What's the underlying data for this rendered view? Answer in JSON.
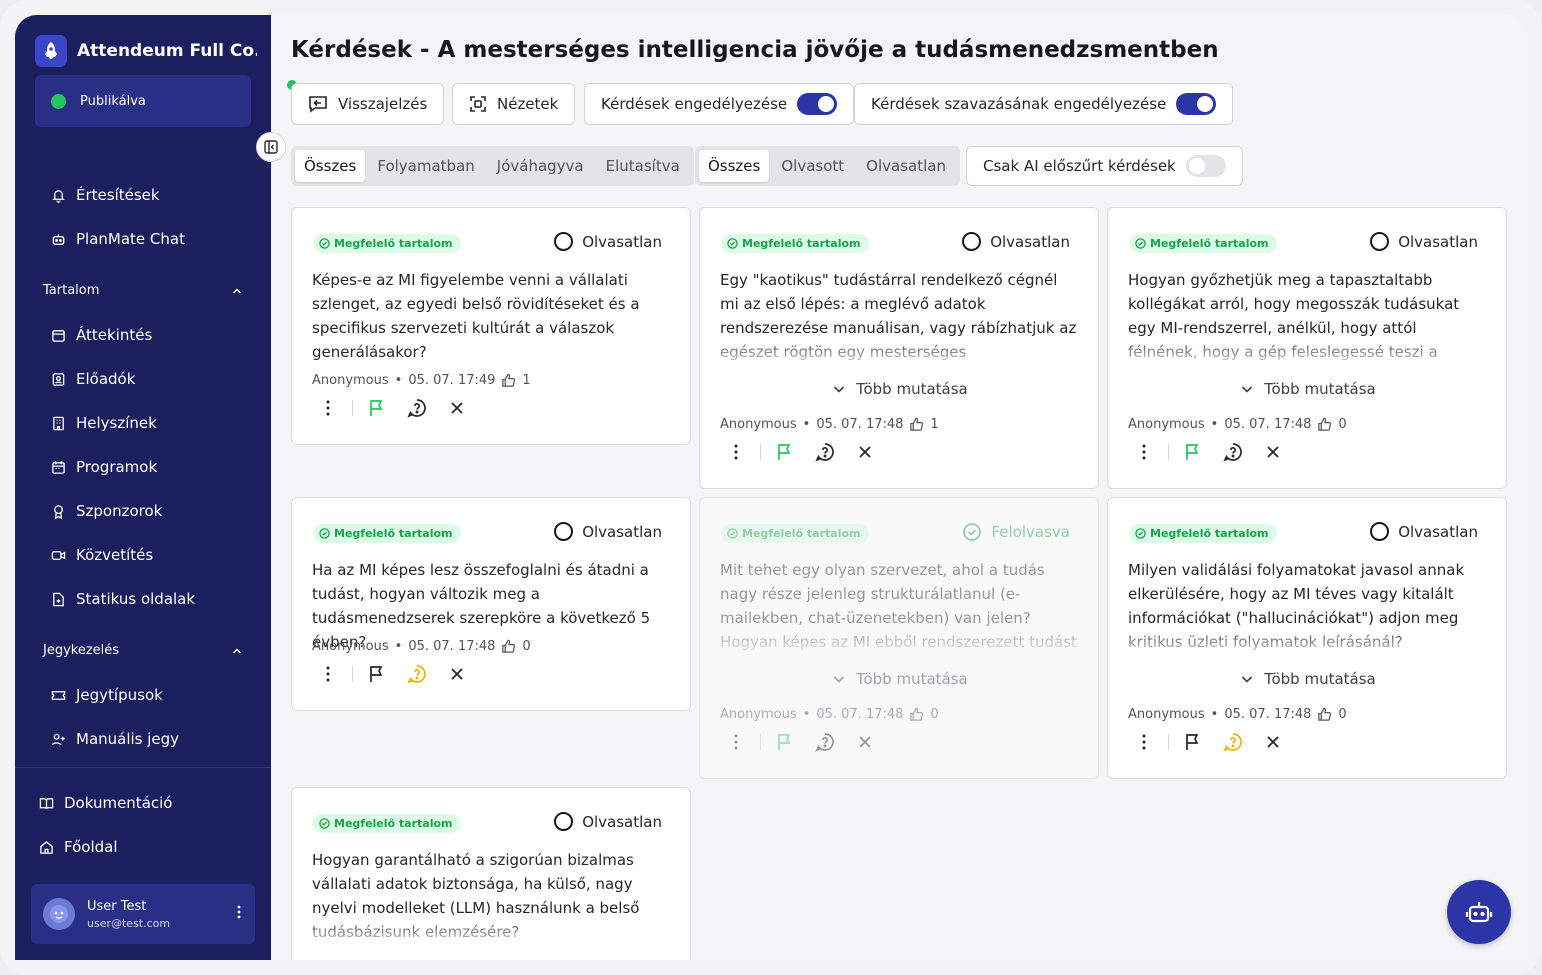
{
  "sidebar": {
    "brand": "Attendeum Full Co...",
    "status": "Publikálva",
    "nav_top": [
      "Értesítések",
      "PlanMate Chat"
    ],
    "section_content": "Tartalom",
    "content_items": [
      "Áttekintés",
      "Előadók",
      "Helyszínek",
      "Programok",
      "Szponzorok",
      "Közvetítés",
      "Statikus oldalak"
    ],
    "section_ticket": "Jegykezelés",
    "ticket_items": [
      "Jegytípusok",
      "Manuális jegy"
    ],
    "bottom_items": [
      "Dokumentáció",
      "Főoldal"
    ],
    "user": {
      "name": "User Test",
      "email": "user@test.com"
    }
  },
  "header": {
    "title": "Kérdések - A mesterséges intelligencia jövője a tudásmenedzsmentben",
    "feedback": "Visszajelzés",
    "views": "Nézetek",
    "allow_questions": "Kérdések engedélyezése",
    "allow_voting": "Kérdések szavazásának engedélyezése"
  },
  "filters": {
    "status_tabs": [
      "Összes",
      "Folyamatban",
      "Jóváhagyva",
      "Elutasítva"
    ],
    "read_tabs": [
      "Összes",
      "Olvasott",
      "Olvasatlan"
    ],
    "ai_filter": "Csak AI előszűrt kérdések"
  },
  "labels": {
    "badge": "Megfelelő tartalom",
    "unread": "Olvasatlan",
    "read": "Felolvasva",
    "more": "Több mutatása"
  },
  "questions": [
    {
      "text": "Képes-e az MI figyelembe venni a vállalati szlenget, az egyedi belső rövidítéseket és a specifikus szervezeti kultúrát a válaszok generálásakor?",
      "author": "Anonymous",
      "time": "05. 07. 17:49",
      "votes": "1"
    },
    {
      "text": "Egy \"kaotikus\" tudástárral rendelkező cégnél mi az első lépés: a meglévő adatok rendszerezése manuálisan, vagy rábízhatjuk az egészet rögtön egy mesterséges intelligenciára?",
      "author": "Anonymous",
      "time": "05. 07. 17:48",
      "votes": "1"
    },
    {
      "text": "Hogyan győzhetjük meg a tapasztaltabb kollégákat arról, hogy megosszák tudásukat egy MI-rendszerrel, anélkül, hogy attól félnének, hogy a gép feleslegessé teszi a munkájukat?",
      "author": "Anonymous",
      "time": "05. 07. 17:48",
      "votes": "0"
    },
    {
      "text": "Ha az MI képes lesz összefoglalni és átadni a tudást, hogyan változik meg a tudásmenedzserek szerepköre a következő 5 évben?",
      "author": "Anonymous",
      "time": "05. 07. 17:48",
      "votes": "0"
    },
    {
      "text": "Mit tehet egy olyan szervezet, ahol a tudás nagy része jelenleg strukturálatlanul (e-mailekben, chat-üzenetekben) van jelen? Hogyan képes az MI ebből rendszerezett tudást építeni?",
      "author": "Anonymous",
      "time": "05. 07. 17:48",
      "votes": "0"
    },
    {
      "text": "Milyen validálási folyamatokat javasol annak elkerülésére, hogy az MI téves vagy kitalált információkat (\"hallucinációkat\") adjon meg kritikus üzleti folyamatok leírásánál?",
      "author": "Anonymous",
      "time": "05. 07. 17:48",
      "votes": "0"
    },
    {
      "text": "Hogyan garantálható a szigorúan bizalmas vállalati adatok biztonsága, ha külső, nagy nyelvi modelleket (LLM) használunk a belső tudásbázisunk elemzésére?",
      "author": "",
      "time": "",
      "votes": ""
    }
  ],
  "colors": {
    "sidebar": "#1b1f5e",
    "accent": "#2b35a6",
    "success": "#22c55e",
    "warning": "#eab308"
  }
}
